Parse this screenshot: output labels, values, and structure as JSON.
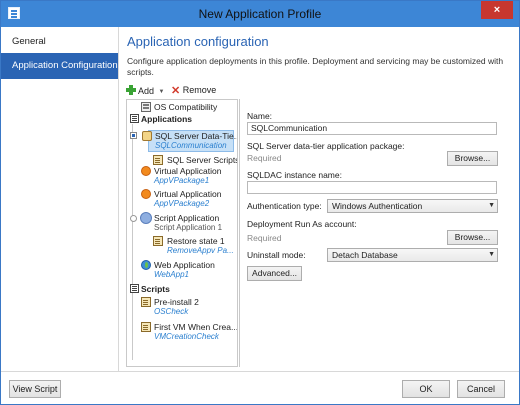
{
  "window": {
    "title": "New Application Profile",
    "close_label": "×"
  },
  "sidebar": {
    "items": [
      {
        "label": "General"
      },
      {
        "label": "Application Configuration"
      }
    ]
  },
  "main": {
    "title": "Application configuration",
    "description": "Configure application deployments in this profile. Deployment and servicing may be customized with scripts.",
    "toolbar": {
      "add_label": "Add",
      "remove_label": "Remove"
    }
  },
  "tree": {
    "os_compat": "OS Compatibility",
    "applications_group": "Applications",
    "items": [
      {
        "title": "SQL Server Data-Tie...",
        "subtitle": "SQLCommunication"
      },
      {
        "title": "SQL Server Scripts"
      },
      {
        "title": "Virtual Application",
        "subtitle": "AppVPackage1"
      },
      {
        "title": "Virtual Application",
        "subtitle": "AppVPackage2"
      },
      {
        "title": "Script Application",
        "subtitle": "Script Application 1"
      },
      {
        "title": "Restore state 1",
        "subtitle": "RemoveAppv Pa..."
      },
      {
        "title": "Web Application",
        "subtitle": "WebApp1"
      }
    ],
    "scripts_group": "Scripts",
    "scripts": [
      {
        "title": "Pre-install 2",
        "subtitle": "OSCheck"
      },
      {
        "title": "First VM When Crea...",
        "subtitle": "VMCreationCheck"
      }
    ]
  },
  "props": {
    "name_label": "Name:",
    "name_value": "SQLCommunication",
    "package_label": "SQL Server data-tier application package:",
    "package_placeholder": "Required",
    "browse_label": "Browse...",
    "instance_label": "SQLDAC instance name:",
    "instance_value": "",
    "auth_label": "Authentication type:",
    "auth_value": "Windows Authentication",
    "runas_label": "Deployment Run As account:",
    "runas_placeholder": "Required",
    "uninstall_label": "Uninstall mode:",
    "uninstall_value": "Detach Database",
    "advanced_label": "Advanced..."
  },
  "footer": {
    "view_script": "View Script",
    "ok": "OK",
    "cancel": "Cancel"
  },
  "colors": {
    "accent": "#2a64b4",
    "titlebar": "#3d86d6",
    "selection": "#c6e0f7",
    "link": "#2a7fcf"
  }
}
